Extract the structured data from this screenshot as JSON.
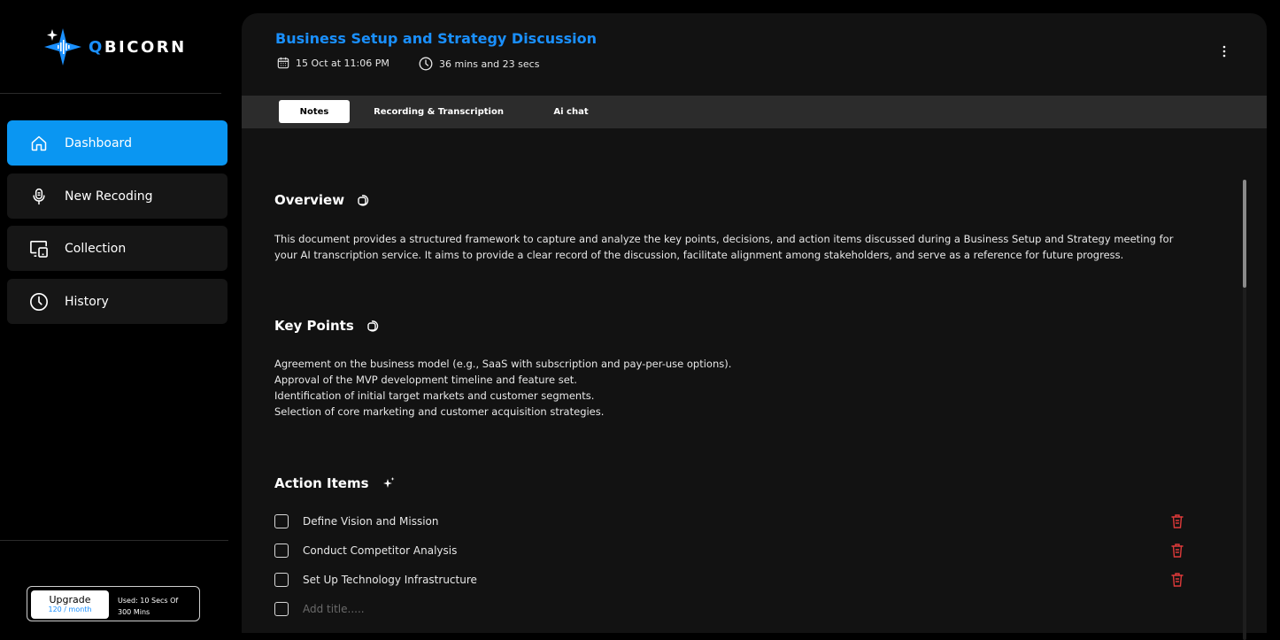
{
  "brand": {
    "name_accent": "Q",
    "name_rest": "BICORN"
  },
  "sidebar": {
    "items": [
      {
        "label": "Dashboard",
        "icon": "home-icon",
        "active": true
      },
      {
        "label": "New Recoding",
        "icon": "microphone-icon",
        "active": false
      },
      {
        "label": "Collection",
        "icon": "devices-icon",
        "active": false
      },
      {
        "label": "History",
        "icon": "clock-icon",
        "active": false
      }
    ],
    "upgrade": {
      "label": "Upgrade",
      "sub": "120 / month",
      "usage_line1": "Used: 10 Secs Of",
      "usage_line2": "300 Mins"
    }
  },
  "meeting": {
    "title": "Business Setup and Strategy Discussion",
    "date": "15 Oct at 11:06 PM",
    "duration": "36 mins and 23 secs"
  },
  "tabs": [
    {
      "label": "Notes",
      "active": true
    },
    {
      "label": "Recording & Transcription",
      "active": false
    },
    {
      "label": "Ai chat",
      "active": false
    }
  ],
  "overview": {
    "heading": "Overview",
    "text": "This document provides a structured framework to capture and analyze the key points, decisions, and action items discussed during a Business Setup and Strategy meeting for your AI transcription service. It aims to provide a clear record of the discussion, facilitate alignment among stakeholders, and serve as a reference for future progress."
  },
  "key_points": {
    "heading": "Key Points",
    "items": [
      "Agreement on the business model (e.g., SaaS with subscription and pay-per-use options).",
      "Approval of the MVP development timeline and feature set.",
      "Identification of initial target markets and customer segments.",
      "Selection of core marketing and customer acquisition strategies."
    ]
  },
  "action_items": {
    "heading": "Action Items",
    "items": [
      {
        "label": "Define Vision and Mission",
        "checked": false
      },
      {
        "label": "Conduct Competitor Analysis",
        "checked": false
      },
      {
        "label": "Set Up Technology Infrastructure",
        "checked": false
      }
    ],
    "add_placeholder": "Add title....."
  },
  "colors": {
    "accent": "#1a90ff",
    "active_nav": "#0a96f2",
    "danger": "#e03a3a",
    "panel": "#121212",
    "tabbar": "#2c2c2c"
  }
}
